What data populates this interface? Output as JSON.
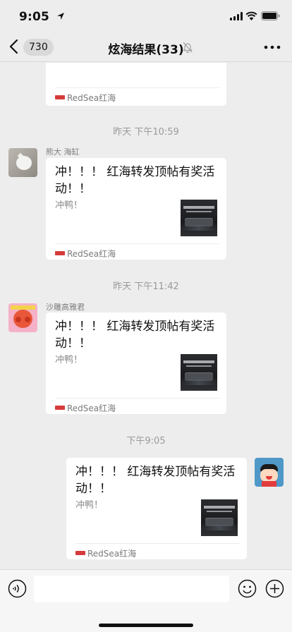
{
  "status_bar": {
    "time": "9:05"
  },
  "nav": {
    "badge_count": "730",
    "title": "炫海结果(33)"
  },
  "messages": [
    {
      "source": "RedSea红海"
    },
    {
      "time": "昨天 下午10:59",
      "sender": "熊大 海缸",
      "title": "冲！！！ 红海转发顶帖有奖活动！！",
      "desc": "冲鸭！",
      "source": "RedSea红海"
    },
    {
      "time": "昨天 下午11:42",
      "sender": "沙雕高雅君",
      "title": "冲！！！ 红海转发顶帖有奖活动！！",
      "desc": "冲鸭！",
      "source": "RedSea红海"
    },
    {
      "time": "下午9:05",
      "title": "冲！！！ 红海转发顶帖有奖活动！！",
      "desc": "冲鸭！",
      "source": "RedSea红海"
    }
  ],
  "input": {
    "value": ""
  }
}
